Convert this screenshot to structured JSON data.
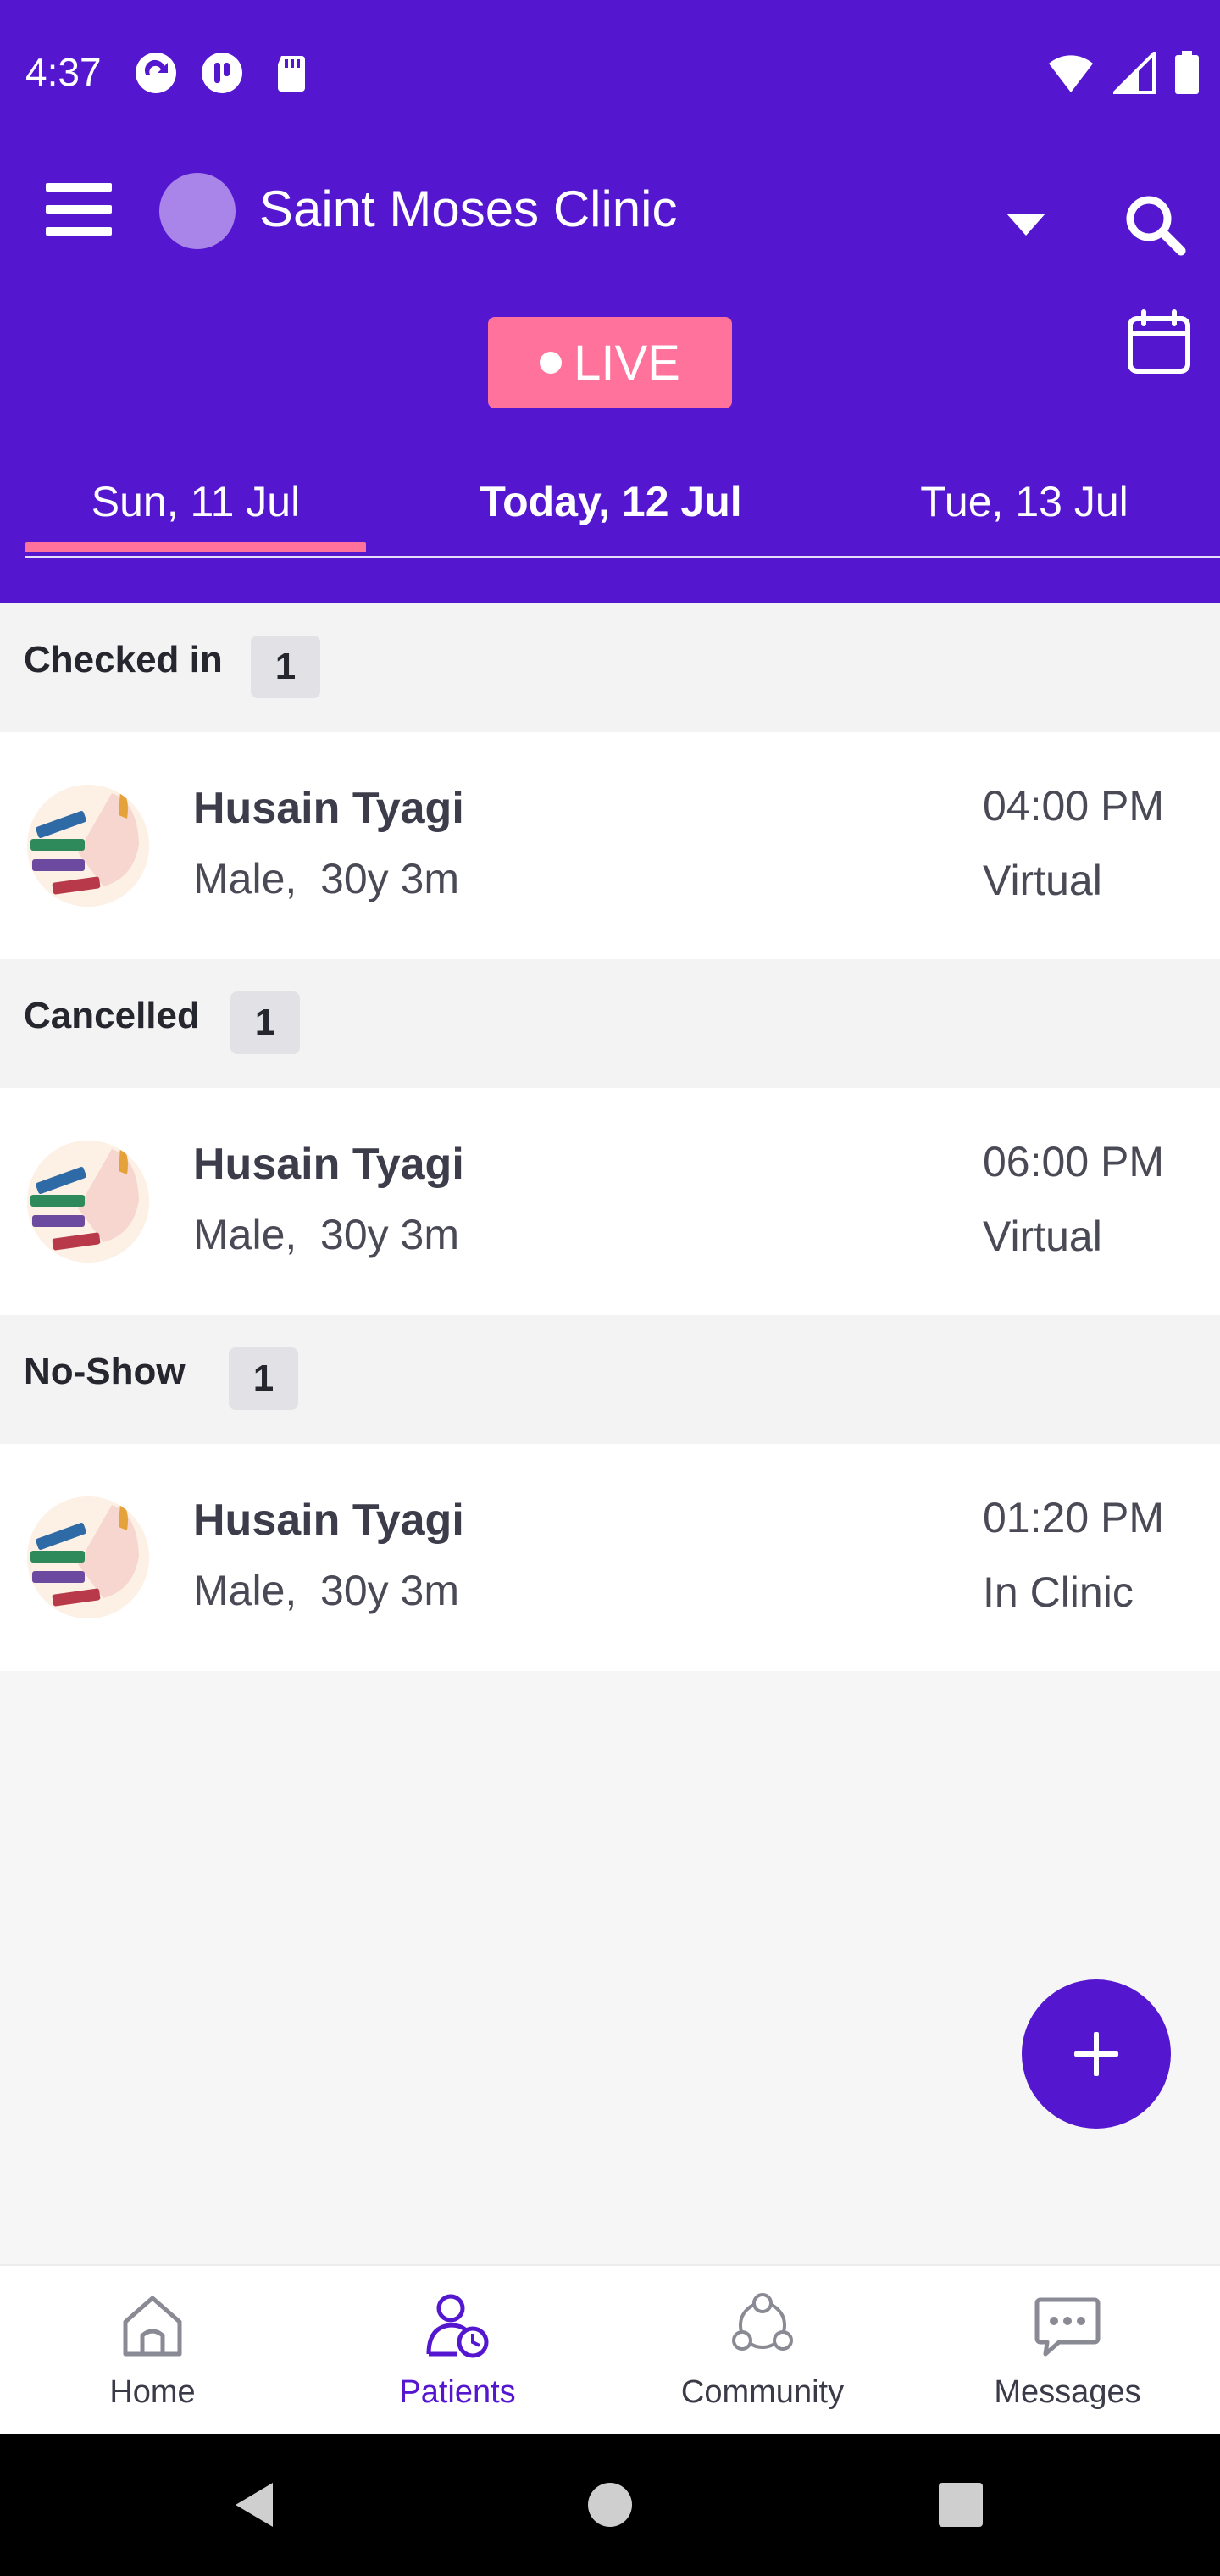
{
  "status_bar": {
    "time": "4:37"
  },
  "header": {
    "clinic_name": "Saint Moses Clinic",
    "live_label": "LIVE"
  },
  "date_tabs": [
    {
      "label": "Sun, 11 Jul",
      "selected": true
    },
    {
      "label": "Today, 12 Jul",
      "selected": false
    },
    {
      "label": "Tue, 13 Jul",
      "selected": false
    }
  ],
  "sections": [
    {
      "title": "Checked in",
      "count": "1",
      "patients": [
        {
          "name": "Husain Tyagi",
          "info": "Male,  30y 3m",
          "time": "04:00 PM",
          "type": "Virtual"
        }
      ]
    },
    {
      "title": "Cancelled",
      "count": "1",
      "patients": [
        {
          "name": "Husain Tyagi",
          "info": "Male,  30y 3m",
          "time": "06:00 PM",
          "type": "Virtual"
        }
      ]
    },
    {
      "title": "No-Show",
      "count": "1",
      "patients": [
        {
          "name": "Husain Tyagi",
          "info": "Male,  30y 3m",
          "time": "01:20 PM",
          "type": "In Clinic"
        }
      ]
    }
  ],
  "bottom_nav": [
    {
      "label": "Home",
      "icon": "home-icon",
      "active": false
    },
    {
      "label": "Patients",
      "icon": "patients-icon",
      "active": true
    },
    {
      "label": "Community",
      "icon": "community-icon",
      "active": false
    },
    {
      "label": "Messages",
      "icon": "messages-icon",
      "active": false
    }
  ],
  "colors": {
    "primary": "#5417cf",
    "live": "#ff729c",
    "background": "#f6f6f6"
  }
}
